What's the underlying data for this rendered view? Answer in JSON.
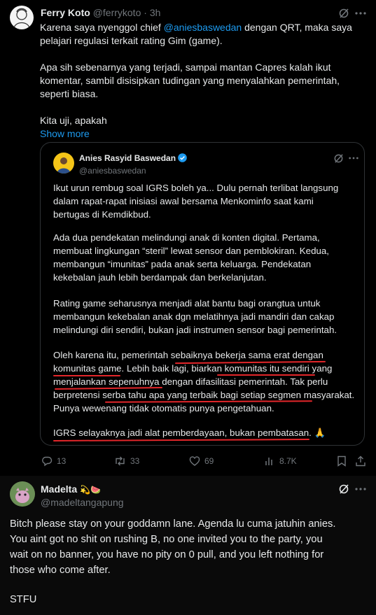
{
  "tweet": {
    "author_name": "Ferry Koto",
    "handle": "@ferrykoto",
    "time": "· 3h",
    "text_before_mention": "Karena saya nyenggol chief ",
    "mention": "@aniesbaswedan",
    "text_after_mention": " dengan QRT, maka saya",
    "line2": "pelajari regulasi terkait rating Gim (game).",
    "para2": "Apa sih sebenarnya yang terjadi, sampai mantan Capres kalah ikut\nkomentar, sambil disisipkan tudingan yang menyalahkan pemerintah,\nseperti biasa.",
    "para3": "Kita uji, apakah",
    "show_more": "Show more",
    "actions": {
      "replies": "13",
      "retweets": "33",
      "likes": "69",
      "views": "8.7K"
    }
  },
  "quote": {
    "author_name": "Anies Rasyid Baswedan",
    "handle": "@aniesbaswedan",
    "p1": "Ikut urun rembug soal IGRS boleh ya... Dulu pernah terlibat langsung\ndalam rapat-rapat inisiasi awal bersama Menkominfo saat kami\nbertugas di Kemdikbud.",
    "p2": "Ada dua pendekatan melindungi anak di konten digital. Pertama,\nmembuat lingkungan “steril” lewat sensor dan pemblokiran. Kedua,\nmembangun “imunitas” pada anak serta keluarga. Pendekatan\nkekebalan jauh lebih berdampak dan berkelanjutan.",
    "p3": "Rating game seharusnya menjadi alat bantu bagi orangtua untuk\nmembangun kekebalan anak dgn melatihnya jadi mandiri dan cakap\nmelindungi diri sendiri, bukan jadi instrumen sensor bagi pemerintah.",
    "p4": "Oleh karena itu, pemerintah sebaiknya bekerja sama erat dengan\nkomunitas game. Lebih baik lagi, biarkan komunitas itu sendiri yang\nmenjalankan sepenuhnya dengan difasilitasi pemerintah. Tak perlu\nberpretensi serba tahu apa yang terbaik bagi setiap segmen masyarakat.\nPunya wewenang tidak otomatis punya pengetahuan.",
    "p5": "IGRS selayaknya jadi alat pemberdayaan, bukan pembatasan. 🙏"
  },
  "reply": {
    "author_name": "Madelta",
    "emojis": "💫🍉",
    "handle": "@madeltangapung",
    "p1": "Bitch please stay on your goddamn lane. Agenda lu cuma jatuhin anies.\nYou aint got no shit on rushing B, no one invited you to the party, you\nwait on no banner, you have no pity on 0 pull, and you left nothing for\nthose who come after.",
    "p2": "STFU"
  },
  "colors": {
    "background": "#000000",
    "text": "#e7e9ea",
    "muted": "#71767b",
    "link": "#1d9bf0",
    "underline": "#e3262a",
    "reply_bg": "#0a0a0a"
  },
  "icons": [
    "grok-icon",
    "more-icon",
    "verified-badge-icon",
    "reply-icon",
    "retweet-icon",
    "like-icon",
    "views-icon",
    "bookmark-icon",
    "share-icon"
  ]
}
